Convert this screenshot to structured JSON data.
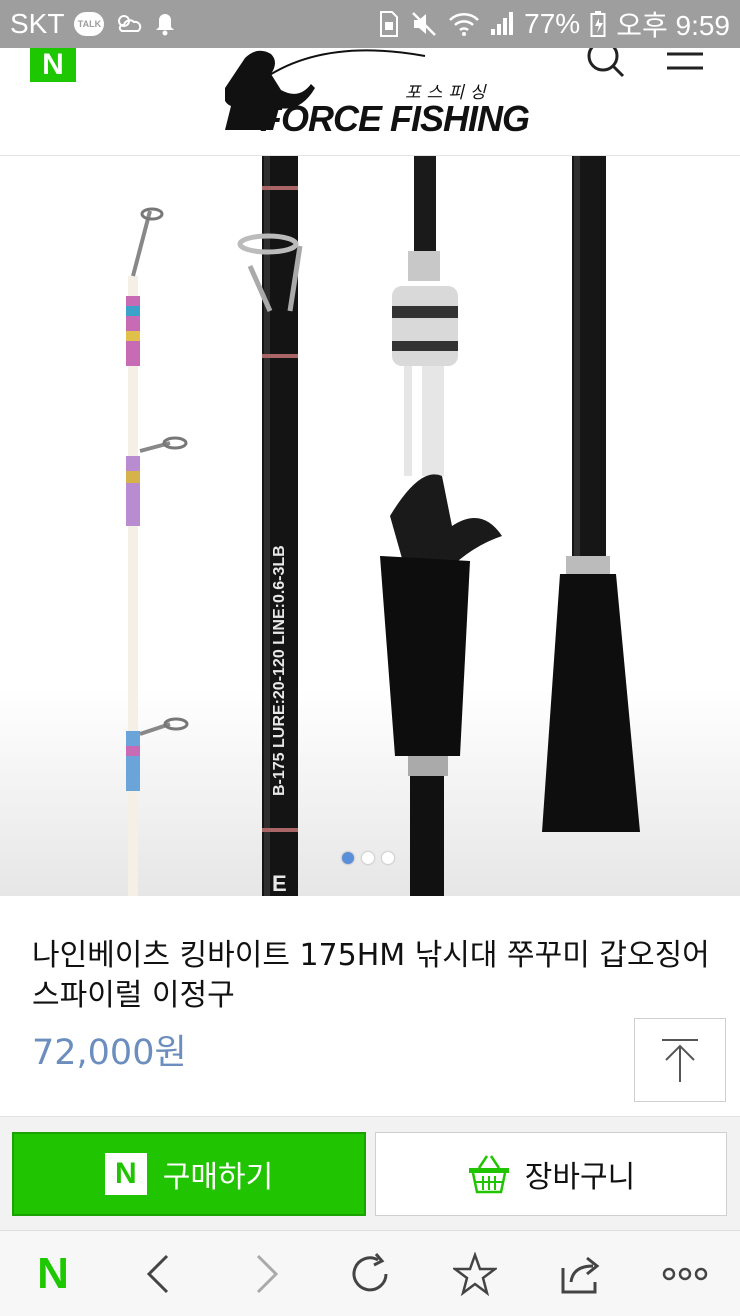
{
  "status_bar": {
    "carrier": "SKT",
    "talk_label": "TALK",
    "battery": "77%",
    "time": "오후 9:59"
  },
  "header": {
    "naver_badge": "N",
    "logo_korean": "포스피싱",
    "logo_text": "FORCE FISHING",
    "icons": [
      "search-icon",
      "menu-icon"
    ]
  },
  "hero": {
    "rod_text": "B-175   LURE:20-120   LINE:0.6-3LB",
    "rod_label_mark": "E",
    "slides": 3,
    "active_slide": 1
  },
  "product": {
    "title": "나인베이츠 킹바이트 175HM 낚시대 쭈꾸미 갑오징어 스파이럴 이정구",
    "price": "72,000원"
  },
  "actions": {
    "buy_icon": "N",
    "buy_label": "구매하기",
    "cart_label": "장바구니"
  },
  "browser_nav": {
    "home": "N",
    "items": [
      "naver-home",
      "back-icon",
      "forward-icon",
      "refresh-icon",
      "star-icon",
      "share-icon",
      "more-icon"
    ]
  },
  "colors": {
    "naver_green": "#1ec800",
    "price_blue": "#6c8ebf",
    "status_gray": "#9e9e9e",
    "dot_active": "#5b8ed8"
  }
}
